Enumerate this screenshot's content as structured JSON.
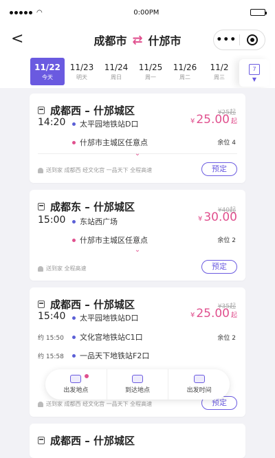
{
  "status": {
    "time": "0:00PM"
  },
  "nav": {
    "from": "成都市",
    "to": "什邡市",
    "back_label": "<",
    "more_label": "•••"
  },
  "dates": [
    {
      "day": "11/22",
      "week": "今天",
      "active": true
    },
    {
      "day": "11/23",
      "week": "明天"
    },
    {
      "day": "11/24",
      "week": "周日"
    },
    {
      "day": "11/25",
      "week": "周一"
    },
    {
      "day": "11/26",
      "week": "周二"
    },
    {
      "day": "11/2",
      "week": "周三"
    }
  ],
  "calendar": {
    "num": "7"
  },
  "trips": [
    {
      "title": "成都西 – 什邡城区",
      "time": "14:20",
      "stop1": "太平园地铁站D口",
      "stop2": "什邡市主城区任意点",
      "old_price": "¥25起",
      "currency": "¥",
      "price": "25.00",
      "unit": "起",
      "seats": "余位 4",
      "notes": "送到家  成都西  经文化宫  一品天下  全程高速",
      "book": "预定"
    },
    {
      "title": "成都东 – 什邡城区",
      "time": "15:00",
      "stop1": "东站西广场",
      "stop2": "什邡市主城区任意点",
      "old_price": "¥40起",
      "currency": "¥",
      "price": "30.00",
      "unit": "",
      "seats": "余位 2",
      "notes": "送到家  全程高速",
      "book": "预定"
    },
    {
      "title": "成都西 – 什邡城区",
      "time": "15:40",
      "stop1": "太平园地铁站D口",
      "eta2": "约 15:50",
      "stop2": "文化宫地铁站C1口",
      "eta3": "约 15:58",
      "stop3": "一品天下地铁站F2口",
      "old_price": "¥35起",
      "currency": "¥",
      "price": "25.00",
      "unit": "起",
      "seats": "余位 2",
      "notes": "送到家  成都西  经文化宫  一品天下  全程高速",
      "book": "预定"
    },
    {
      "title": "成都西 – 什邡城区"
    }
  ],
  "bottom_nav": [
    {
      "label": "出发地点"
    },
    {
      "label": "到达地点"
    },
    {
      "label": "出发时间"
    }
  ],
  "colors": {
    "accent": "#6a5ae0",
    "pink": "#e0508e"
  }
}
